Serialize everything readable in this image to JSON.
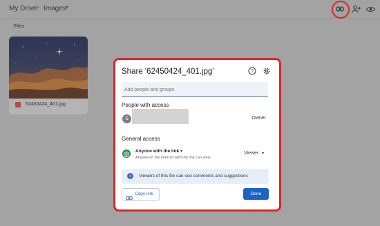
{
  "breadcrumb": {
    "root": "My Drive",
    "separator": ">",
    "current": "Images",
    "caret": "▾"
  },
  "toolbar": {
    "icons": [
      "link-icon",
      "add-person-icon",
      "eye-icon"
    ]
  },
  "files_label": "Files",
  "file": {
    "name": "62450424_401.jpg",
    "icon": "image-file-icon"
  },
  "dialog": {
    "title": "Share '62450424_401.jpg'",
    "help_icon": "help-icon",
    "settings_icon": "gear-icon",
    "add_people_placeholder": "Add people and groups",
    "people_heading": "People with access",
    "owner": {
      "avatar_letter": "S",
      "role": "Owner"
    },
    "general_heading": "General access",
    "general_access": {
      "mode": "Anyone with the link",
      "mode_caret": "▾",
      "description": "Anyone on the internet with the link can view",
      "role": "Viewer",
      "role_caret": "▾"
    },
    "info_text": "Viewers of this file can see comments and suggestions",
    "copy_link_label": "Copy link",
    "done_label": "Done"
  },
  "colors": {
    "highlight": "#d42a2a",
    "primary": "#1e62c8",
    "link": "#2f5fb8"
  }
}
